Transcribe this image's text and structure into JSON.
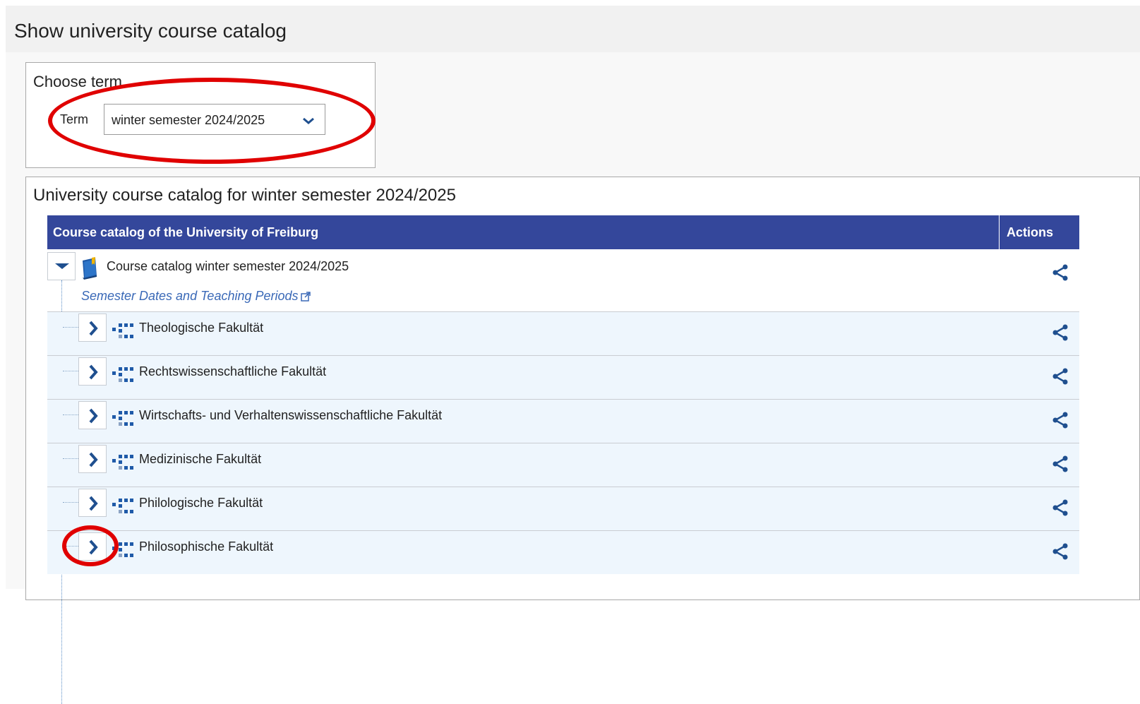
{
  "page": {
    "title": "Show university course catalog"
  },
  "term_section": {
    "legend": "Choose term",
    "label": "Term",
    "selected": "winter semester 2024/2025"
  },
  "catalog": {
    "legend": "University course catalog for winter semester 2024/2025",
    "header": {
      "main": "Course catalog of the University of Freiburg",
      "actions": "Actions"
    },
    "root": {
      "label": "Course catalog winter semester 2024/2025",
      "link": "Semester Dates and Teaching Periods"
    },
    "faculties": [
      {
        "label": "Theologische Fakultät"
      },
      {
        "label": "Rechtswissenschaftliche Fakultät"
      },
      {
        "label": "Wirtschafts- und Verhaltenswissenschaftliche Fakultät"
      },
      {
        "label": "Medizinische Fakultät"
      },
      {
        "label": "Philologische Fakultät"
      },
      {
        "label": "Philosophische Fakultät"
      }
    ]
  },
  "icons": {
    "expand": "chevron-right-icon",
    "collapse": "chevron-down-icon",
    "share": "share-icon",
    "book": "book-icon",
    "org": "org-unit-icon",
    "external": "external-link-icon"
  },
  "colors": {
    "header_bg": "#34479b",
    "link": "#3a69b7",
    "row_bg": "#eef6fd",
    "toggle_arrow": "#1f4f8f",
    "annotation": "#e00000"
  }
}
